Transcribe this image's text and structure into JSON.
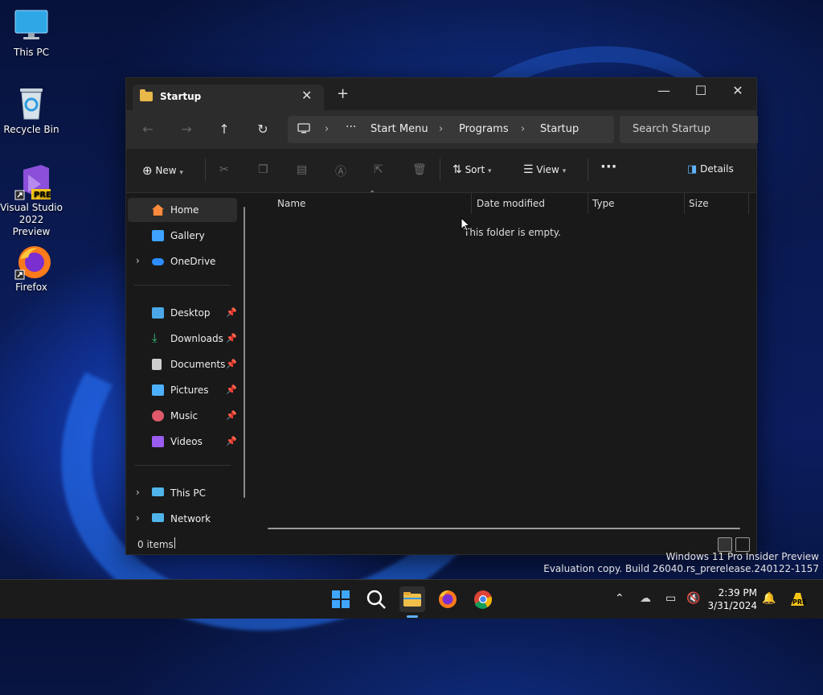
{
  "desktop": {
    "icons": [
      {
        "label": "This PC"
      },
      {
        "label": "Recycle Bin"
      },
      {
        "label": "Visual Studio 2022 Preview",
        "badge": "PRE"
      },
      {
        "label": "Firefox"
      }
    ]
  },
  "window": {
    "tab_title": "Startup",
    "breadcrumb": [
      "Start Menu",
      "Programs",
      "Startup"
    ],
    "search_placeholder": "Search Startup",
    "toolbar": {
      "new": "New",
      "sort": "Sort",
      "view": "View",
      "details": "Details"
    },
    "sidebar": [
      {
        "label": "Home",
        "icon": "home-icon",
        "color": "#ff8a3d"
      },
      {
        "label": "Gallery",
        "icon": "gallery-icon",
        "color": "#3ea1ff"
      },
      {
        "label": "OneDrive",
        "icon": "onedrive-icon",
        "color": "#2d8cff"
      },
      {
        "label": "Desktop",
        "icon": "desktop-icon",
        "color": "#4aa8e8"
      },
      {
        "label": "Downloads",
        "icon": "download-icon",
        "color": "#39c07a"
      },
      {
        "label": "Documents",
        "icon": "document-icon",
        "color": "#cfcfcf"
      },
      {
        "label": "Pictures",
        "icon": "pictures-icon",
        "color": "#4db0ff"
      },
      {
        "label": "Music",
        "icon": "music-icon",
        "color": "#e05a6b"
      },
      {
        "label": "Videos",
        "icon": "videos-icon",
        "color": "#9b5cf0"
      },
      {
        "label": "This PC",
        "icon": "pc-icon",
        "color": "#4fb4ea"
      },
      {
        "label": "Network",
        "icon": "network-icon",
        "color": "#4fb4ea"
      }
    ],
    "columns": [
      "Name",
      "Date modified",
      "Type",
      "Size"
    ],
    "empty_message": "This folder is empty.",
    "status_count": "0 items"
  },
  "watermark": {
    "line1": "Windows 11 Pro Insider Preview",
    "line2": "Evaluation copy. Build 26040.rs_prerelease.240122-1157"
  },
  "taskbar": {
    "time": "2:39 PM",
    "date": "3/31/2024",
    "tray_badge": "PRE"
  }
}
